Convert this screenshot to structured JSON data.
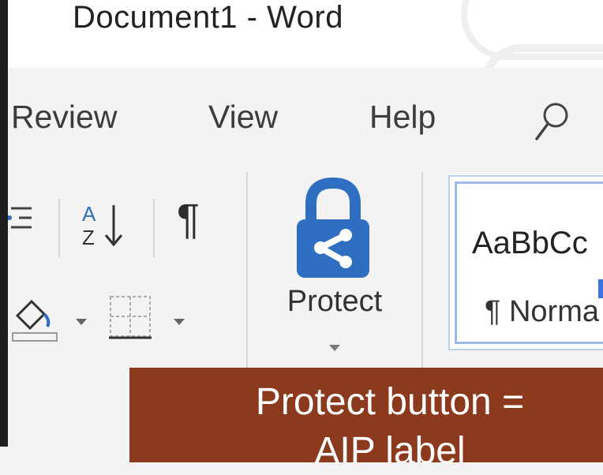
{
  "window": {
    "title": "Document1  -  Word"
  },
  "tabs": [
    {
      "label": "Review"
    },
    {
      "label": "View"
    },
    {
      "label": "Help"
    }
  ],
  "icons": {
    "search": "search-icon",
    "list": "list-icon",
    "sort": "sort-az-icon",
    "show_hide": "pilcrow-icon",
    "shading": "shading-bucket-icon",
    "borders": "borders-icon",
    "protect": "lock-share-icon"
  },
  "ribbon": {
    "show_hide_glyph": "¶",
    "protect_label": "Protect"
  },
  "styles": {
    "sample_text": "AaBbCc",
    "normal_label": "¶ Norma"
  },
  "annotation": {
    "line1": "Protect button =",
    "line2": "AIP label"
  },
  "colors": {
    "lock": "#2f6fc1",
    "annotation_bg": "#8c3a1d",
    "styles_border": "#9ebbe8"
  }
}
